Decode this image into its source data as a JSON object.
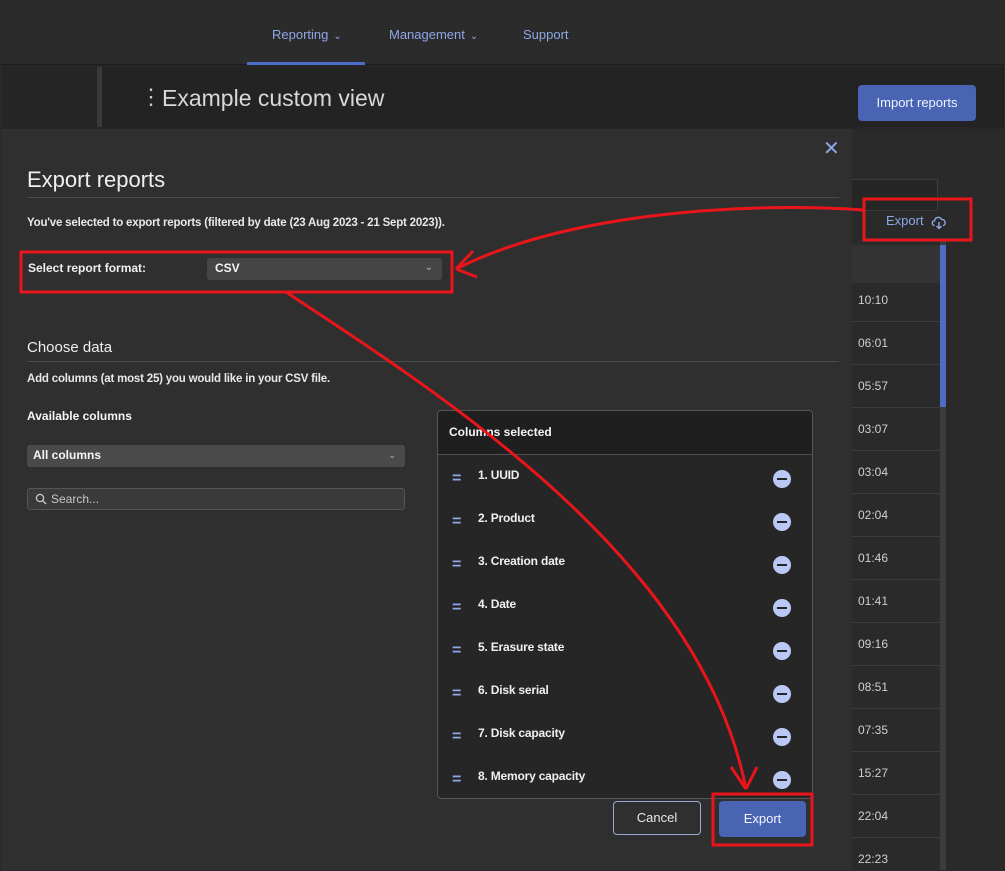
{
  "nav": {
    "items": [
      {
        "label": "Reporting",
        "dropdown": true
      },
      {
        "label": "Management",
        "dropdown": true
      },
      {
        "label": "Support",
        "dropdown": false
      }
    ]
  },
  "header": {
    "view_title": "Example custom view",
    "import_label": "Import reports"
  },
  "background_table": {
    "export_label": "Export",
    "times": [
      "10:10",
      "06:01",
      "05:57",
      "03:07",
      "03:04",
      "02:04",
      "01:46",
      "01:41",
      "09:16",
      "08:51",
      "07:35",
      "15:27",
      "22:04",
      "22:23"
    ]
  },
  "modal": {
    "title": "Export reports",
    "subtitle": "You've selected to export reports (filtered by date (23 Aug 2023 - 21 Sept 2023)).",
    "format_label": "Select report format:",
    "format_value": "CSV",
    "choose_title": "Choose data",
    "choose_desc": "Add columns (at most 25) you would like in your CSV file.",
    "available_label": "Available columns",
    "columns_filter_value": "All columns",
    "search_placeholder": "Search...",
    "selected_header": "Columns selected",
    "selected_columns": [
      "1. UUID",
      "2. Product",
      "3. Creation date",
      "4. Date",
      "5. Erasure state",
      "6. Disk serial",
      "7. Disk capacity",
      "8. Memory capacity"
    ],
    "cancel_label": "Cancel",
    "export_label": "Export"
  },
  "colors": {
    "accent": "#4a64b4",
    "annotation": "#e8151b",
    "background": "#262626"
  }
}
